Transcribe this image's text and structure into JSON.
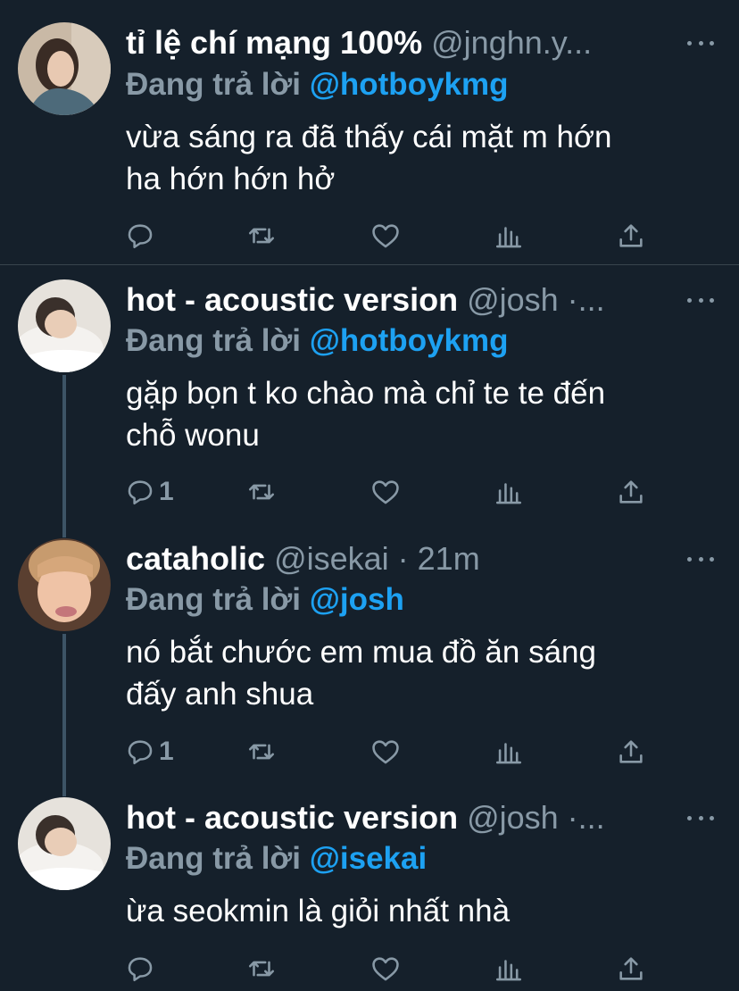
{
  "replying_label": "Đang trả lời",
  "colors": {
    "background": "#15202b",
    "muted": "#8899a6",
    "mention": "#1da1f2",
    "divider": "#38444d",
    "thread_line": "#3d5466"
  },
  "action_icons": [
    "reply-icon",
    "retweet-icon",
    "like-icon",
    "analytics-icon",
    "share-icon"
  ],
  "tweets": [
    {
      "name": "tỉ lệ chí mạng 100%",
      "meta": "@jnghn.y...",
      "replying_to": "@hotboykmg",
      "text_lines": [
        "vừa sáng ra đã thấy cái mặt m hớn",
        "ha hớn hớn hở"
      ],
      "reply_count": ""
    },
    {
      "name": "hot - acoustic version",
      "meta": "@josh ·...",
      "replying_to": "@hotboykmg",
      "text_lines": [
        "gặp bọn t ko chào mà chỉ te te đến",
        "chỗ wonu"
      ],
      "reply_count": "1"
    },
    {
      "name": "cataholic",
      "meta": "@isekai · 21m",
      "replying_to": "@josh",
      "text_lines": [
        "nó bắt chước em mua đồ ăn sáng",
        "đấy anh shua"
      ],
      "reply_count": "1"
    },
    {
      "name": "hot - acoustic version",
      "meta": "@josh ·...",
      "replying_to": "@isekai",
      "text_lines": [
        "ừa seokmin là giỏi nhất nhà"
      ],
      "reply_count": ""
    }
  ]
}
